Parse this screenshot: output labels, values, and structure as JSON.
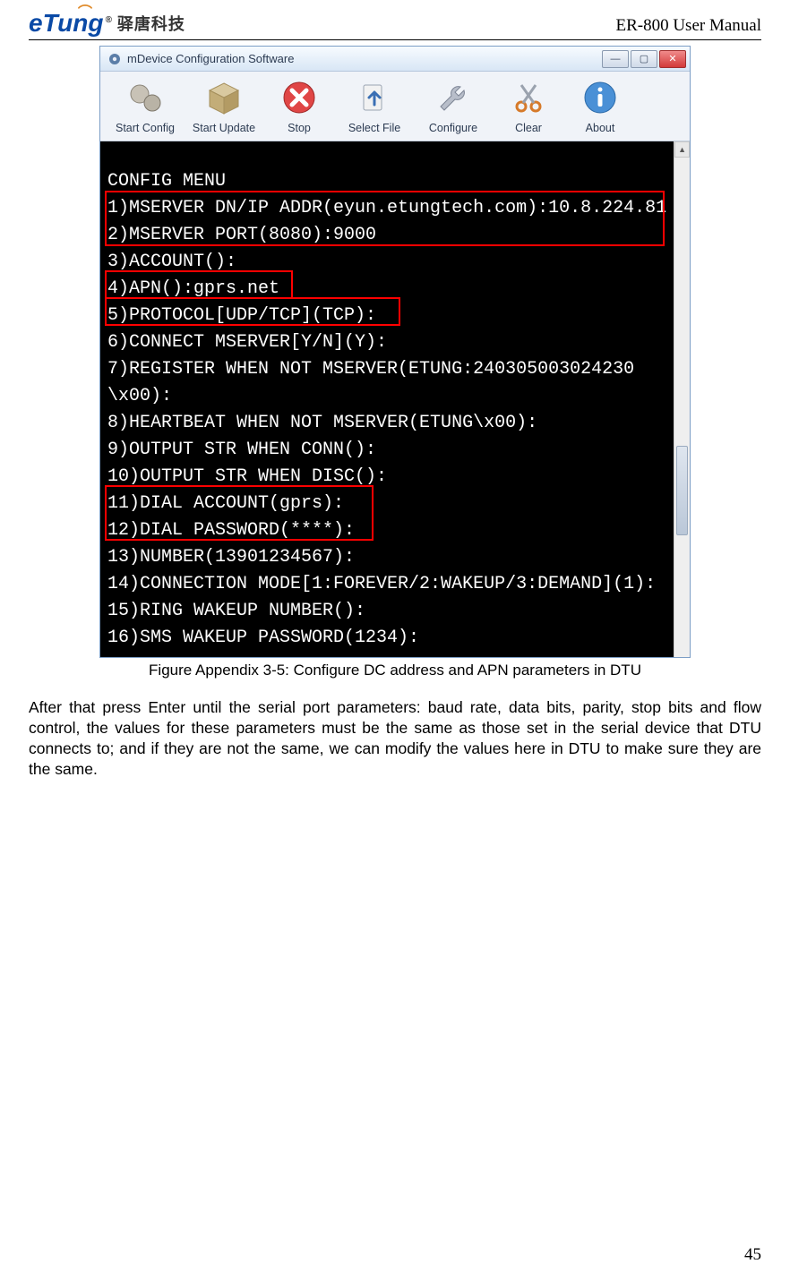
{
  "header": {
    "logo_text": "eTung",
    "logo_reg": "®",
    "logo_cn": "驿唐科技",
    "doc_title": "ER-800 User Manual"
  },
  "window": {
    "title": "mDevice Configuration Software",
    "controls": {
      "min": "—",
      "max": "▢",
      "close": "✕"
    },
    "toolbar": [
      {
        "label": "Start Config"
      },
      {
        "label": "Start Update"
      },
      {
        "label": "Stop"
      },
      {
        "label": "Select File"
      },
      {
        "label": "Configure"
      },
      {
        "label": "Clear"
      },
      {
        "label": "About"
      }
    ],
    "terminal": {
      "heading": "CONFIG MENU",
      "lines": [
        "1)MSERVER DN/IP ADDR(eyun.etungtech.com):10.8.224.81",
        "2)MSERVER PORT(8080):9000",
        "3)ACCOUNT():",
        "4)APN():gprs.net",
        "5)PROTOCOL[UDP/TCP](TCP):",
        "6)CONNECT MSERVER[Y/N](Y):",
        "7)REGISTER WHEN NOT MSERVER(ETUNG:240305003024230",
        "\\x00):",
        "8)HEARTBEAT WHEN NOT MSERVER(ETUNG\\x00):",
        "9)OUTPUT STR WHEN CONN():",
        "10)OUTPUT STR WHEN DISC():",
        "11)DIAL ACCOUNT(gprs):",
        "12)DIAL PASSWORD(****):",
        "13)NUMBER(13901234567):",
        "14)CONNECTION MODE[1:FOREVER/2:WAKEUP/3:DEMAND](1):",
        "15)RING WAKEUP NUMBER():",
        "16)SMS WAKEUP PASSWORD(1234):"
      ]
    }
  },
  "caption": "Figure Appendix 3-5: Configure DC address and APN parameters in DTU",
  "body": "After that press Enter until the serial port parameters: baud rate, data bits, parity, stop bits and flow control, the values for these parameters must be the same as those set in the serial device that DTU connects to; and if they are not the same, we can modify the values here in DTU to make sure they are the same.",
  "page_number": "45"
}
